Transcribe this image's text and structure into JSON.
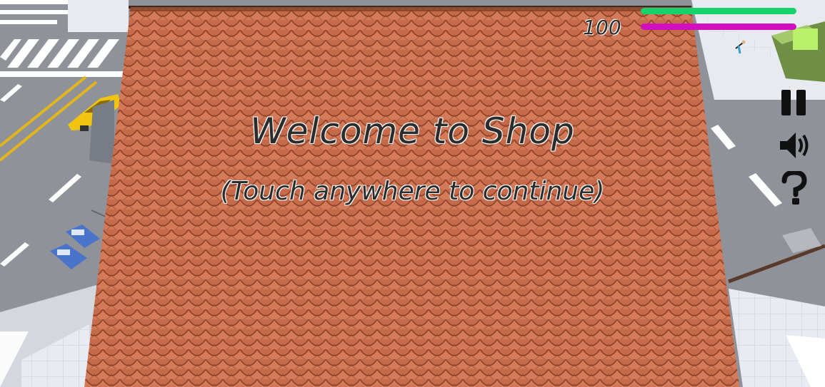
{
  "screen": {
    "title": "Welcome to Shop",
    "subtitle": "(Touch anywhere to continue)"
  },
  "hud": {
    "coins": "100",
    "health_fraction": 1.0,
    "energy_fraction": 1.0,
    "health_color": "#14d36b",
    "energy_color": "#d10fbf",
    "buttons": [
      "pause-icon",
      "sound-icon",
      "help-icon"
    ]
  },
  "colors": {
    "roof": "#c56a4b",
    "roof_shadow": "#8a4128",
    "road": "#8f9399",
    "sidewalk": "#e8eaf0",
    "taxi": "#f1c40f",
    "lane_marking": "#ffffff",
    "center_line": "#e3b51c"
  }
}
